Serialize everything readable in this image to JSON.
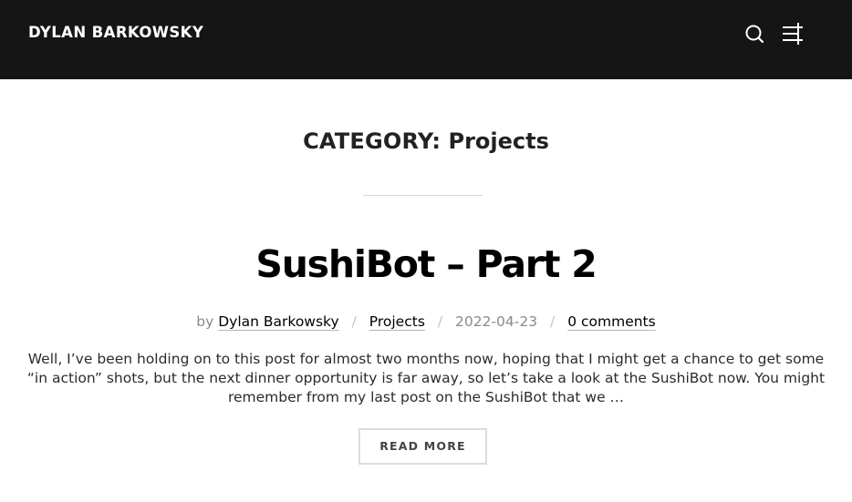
{
  "header": {
    "site_title": "DYLAN BARKOWSKY",
    "search_icon": "search-icon",
    "menu_icon": "menu-toggle-icon",
    "background_color": "#151515"
  },
  "archive": {
    "prefix": "CATEGORY:",
    "name": "Projects"
  },
  "post": {
    "title": "SushiBot – Part 2",
    "meta": {
      "by_label": "by",
      "author": "Dylan Barkowsky",
      "category": "Projects",
      "date": "2022-04-23",
      "comments": "0 comments"
    },
    "excerpt": "Well, I’ve been holding on to this post for almost two months now, hoping that I might get a chance to get some “in action” shots, but the next dinner opportunity is far away, so let’s take a look at the SushiBot now. You might remember from my last post on the SushiBot that we …",
    "read_more_label": "READ MORE"
  }
}
